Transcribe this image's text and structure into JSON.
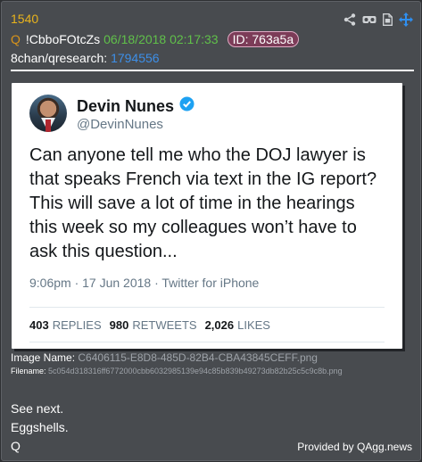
{
  "post": {
    "number": "1540",
    "q_mark": "Q",
    "tripcode": "!CbboFOtcZs",
    "datetime": "06/18/2018 02:17:33",
    "id_label": "ID: 763a5a",
    "board_prefix": "8chan/qresearch:",
    "board_post_link": "1794556",
    "toolbar_icons": [
      "share-icon",
      "glasses-icon",
      "document-icon",
      "move-icon"
    ],
    "colors": {
      "post_number": "#e8b31c",
      "datetime": "#60c04a",
      "link": "#3d8fe8",
      "id_badge_bg": "#7c3c58"
    }
  },
  "tweet": {
    "name": "Devin Nunes",
    "handle": "@DevinNunes",
    "verified_icon": "verified-check-icon",
    "text": "Can anyone tell me who the DOJ lawyer is that speaks French via text in the IG report?  This will save a lot of time in the hearings this week so my colleagues won’t have to ask this question...",
    "meta": "9:06pm · 17 Jun 2018 · Twitter for iPhone",
    "replies_count": "403",
    "replies_label": "REPLIES",
    "retweets_count": "980",
    "retweets_label": "RETWEETS",
    "likes_count": "2,026",
    "likes_label": "LIKES"
  },
  "file": {
    "image_name_label": "Image Name:",
    "image_name": "C6406115-E8D8-485D-82B4-CBA43845CEFF.png",
    "filename_label": "Filename:",
    "filename": "5c054d318316ff6772000cbb6032985139e94c85b839b49273db82b25c5c9c8b.png"
  },
  "body": {
    "line1": "See next.",
    "line2": "Eggshells.",
    "line3": "Q"
  },
  "footer": {
    "provided_by": "Provided by QAgg.news"
  }
}
